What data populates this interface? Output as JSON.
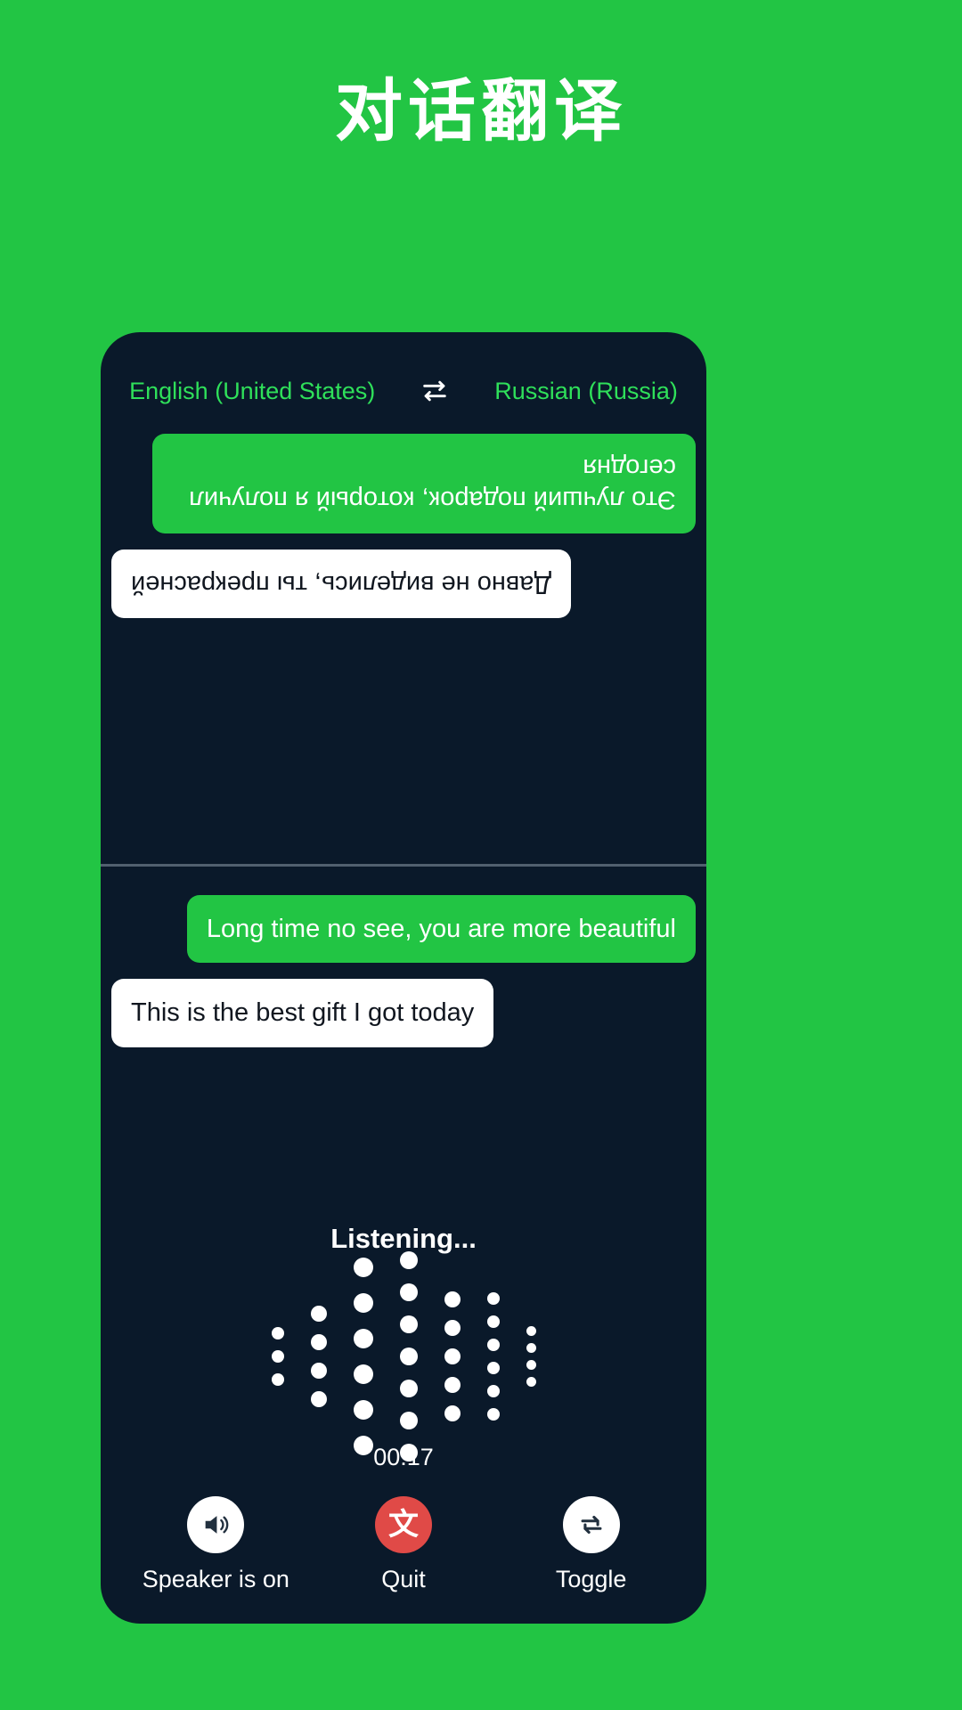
{
  "page": {
    "title": "对话翻译",
    "background_color": "#22c544"
  },
  "device": {
    "background_color": "#0a192a"
  },
  "language_bar": {
    "source_language": "English (United States)",
    "target_language": "Russian (Russia)",
    "swap_icon": "swap-horizontal-icon",
    "text_color": "#2fe05a"
  },
  "conversation": {
    "top_pane_rotated": true,
    "top_pane_messages": [
      {
        "text": "Это лучший подарок, который я получил сегодня",
        "side": "left",
        "style": "green",
        "language": "ru"
      },
      {
        "text": "Давно не виделись, ты прекрасней",
        "side": "right",
        "style": "white",
        "language": "ru"
      }
    ],
    "bottom_pane_messages": [
      {
        "text": "Long time no see, you are more beautiful",
        "side": "right",
        "style": "green",
        "language": "en"
      },
      {
        "text": "This is the best gift I got today",
        "side": "left",
        "style": "white",
        "language": "en"
      }
    ]
  },
  "status": {
    "listening_label": "Listening...",
    "timer": "00:17"
  },
  "waveform": {
    "columns": [
      {
        "count": 3,
        "size": 14
      },
      {
        "count": 4,
        "size": 18
      },
      {
        "count": 6,
        "size": 22
      },
      {
        "count": 7,
        "size": 20
      },
      {
        "count": 5,
        "size": 18
      },
      {
        "count": 6,
        "size": 14
      },
      {
        "count": 4,
        "size": 11
      }
    ],
    "dot_color": "#ffffff"
  },
  "controls": [
    {
      "label": "Speaker is on",
      "icon": "speaker-on-icon",
      "circle_color": "#ffffff"
    },
    {
      "label": "Quit",
      "icon": "translate-icon",
      "circle_color": "#e04a47"
    },
    {
      "label": "Toggle",
      "icon": "repeat-arrows-icon",
      "circle_color": "#ffffff"
    }
  ]
}
